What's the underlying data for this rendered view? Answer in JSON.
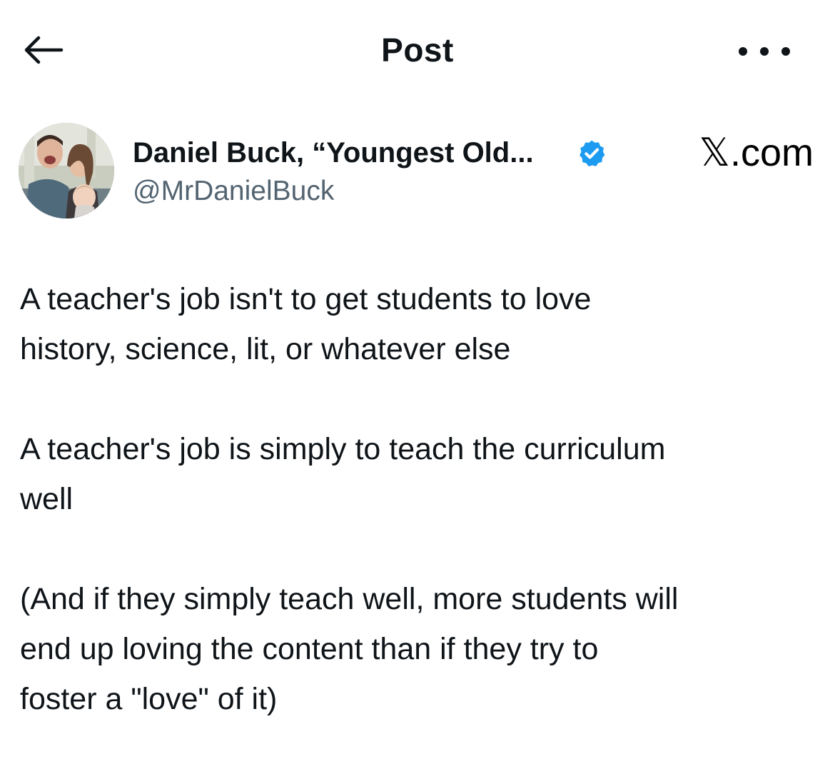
{
  "header": {
    "title": "Post",
    "back_icon": "back-arrow-icon",
    "more_icon": "more-horizontal-icon"
  },
  "author": {
    "display_name": "Daniel Buck, “Youngest Old...",
    "handle": "@MrDanielBuck",
    "verified": true,
    "verified_color": "#1d9bf0"
  },
  "brand": {
    "x_glyph": "𝕏",
    "suffix": ".com"
  },
  "post": {
    "lines": [
      "A teacher's job isn't to get students to love\nhistory, science, lit, or whatever else",
      "A teacher's job is simply to teach the curriculum\nwell",
      "(And if they simply teach well, more students will\nend up loving the content than if they try to\nfoster a \"love\" of it)"
    ]
  },
  "colors": {
    "text": "#0f1419",
    "secondary": "#536471",
    "background": "#ffffff",
    "accent": "#1d9bf0"
  }
}
